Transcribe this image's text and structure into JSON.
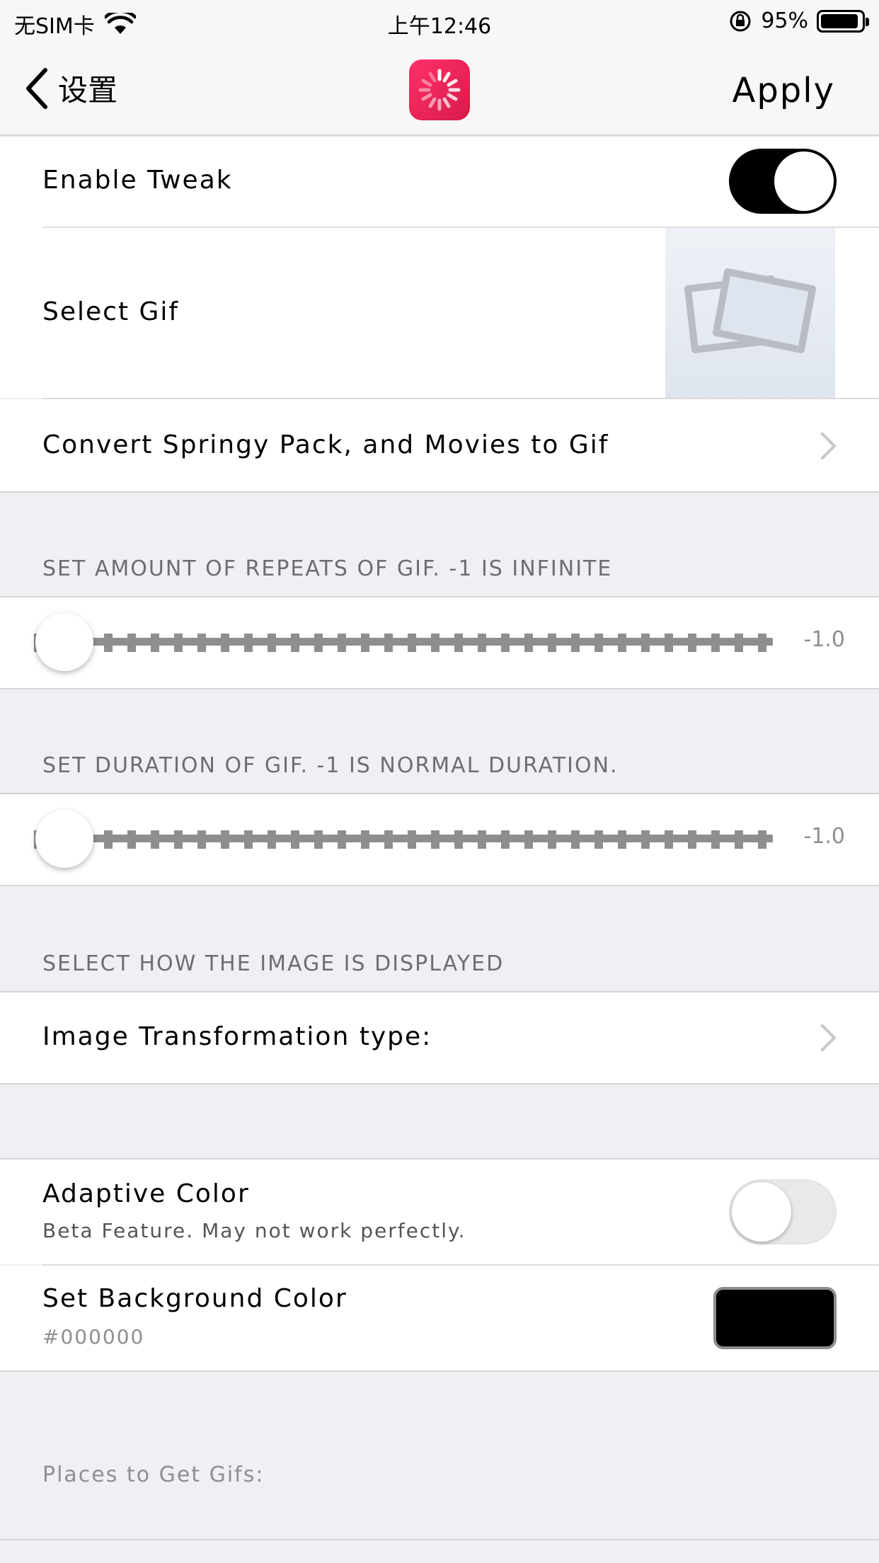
{
  "status_bar": {
    "carrier": "无SIM卡",
    "time": "上午12:46",
    "battery": "95%"
  },
  "nav": {
    "back_label": "设置",
    "apply_label": "Apply"
  },
  "enable_tweak": {
    "label": "Enable Tweak",
    "on": true
  },
  "select_gif": {
    "label": "Select Gif"
  },
  "convert": {
    "label": "Convert Springy Pack, and Movies to Gif"
  },
  "repeats": {
    "header": "SET AMOUNT OF REPEATS OF GIF. -1 IS INFINITE",
    "value": "-1.0"
  },
  "duration": {
    "header": "SET DURATION OF GIF. -1 IS NORMAL DURATION.",
    "value": "-1.0"
  },
  "display": {
    "header": "SELECT HOW THE IMAGE IS DISPLAYED",
    "transform_label": "Image Transformation type:"
  },
  "adaptive_color": {
    "label": "Adaptive Color",
    "sub": "Beta Feature. May not work perfectly.",
    "on": false
  },
  "background_color": {
    "label": "Set Background Color",
    "value": "#000000",
    "swatch": "#000000"
  },
  "places": {
    "header": "Places to Get Gifs:"
  }
}
